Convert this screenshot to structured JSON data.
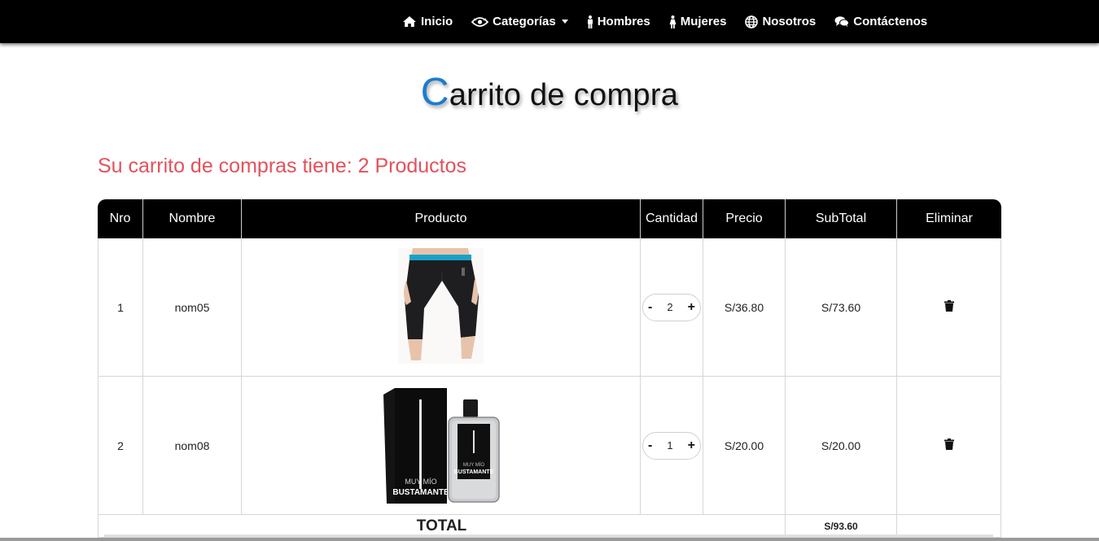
{
  "nav": {
    "items": [
      {
        "label": "Inicio",
        "icon": "home-icon"
      },
      {
        "label": "Categorías",
        "icon": "eye-icon",
        "dropdown": true
      },
      {
        "label": "Hombres",
        "icon": "male-icon"
      },
      {
        "label": "Mujeres",
        "icon": "female-icon"
      },
      {
        "label": "Nosotros",
        "icon": "globe-icon"
      },
      {
        "label": "Contáctenos",
        "icon": "comments-icon"
      }
    ]
  },
  "page": {
    "title_first": "C",
    "title_rest": "arrito de compra",
    "summary": "Su carrito de compras tiene: 2 Productos"
  },
  "table": {
    "headers": [
      "Nro",
      "Nombre",
      "Producto",
      "Cantidad",
      "Precio",
      "SubTotal",
      "Eliminar"
    ],
    "rows": [
      {
        "nro": "1",
        "nombre": "nom05",
        "product_image": "black-leggings",
        "cantidad": "2",
        "precio": "S/36.80",
        "subtotal": "S/73.60"
      },
      {
        "nro": "2",
        "nombre": "nom08",
        "product_image": "perfume-bottle",
        "cantidad": "1",
        "precio": "S/20.00",
        "subtotal": "S/20.00"
      }
    ],
    "total_label": "TOTAL",
    "total_value": "S/93.60"
  },
  "perfume": {
    "line1": "MUY MÍO",
    "line2": "BUSTAMANTE"
  },
  "colors": {
    "accent": "#1a7cd0",
    "summary": "#e3525b",
    "header_bg": "#000000"
  }
}
